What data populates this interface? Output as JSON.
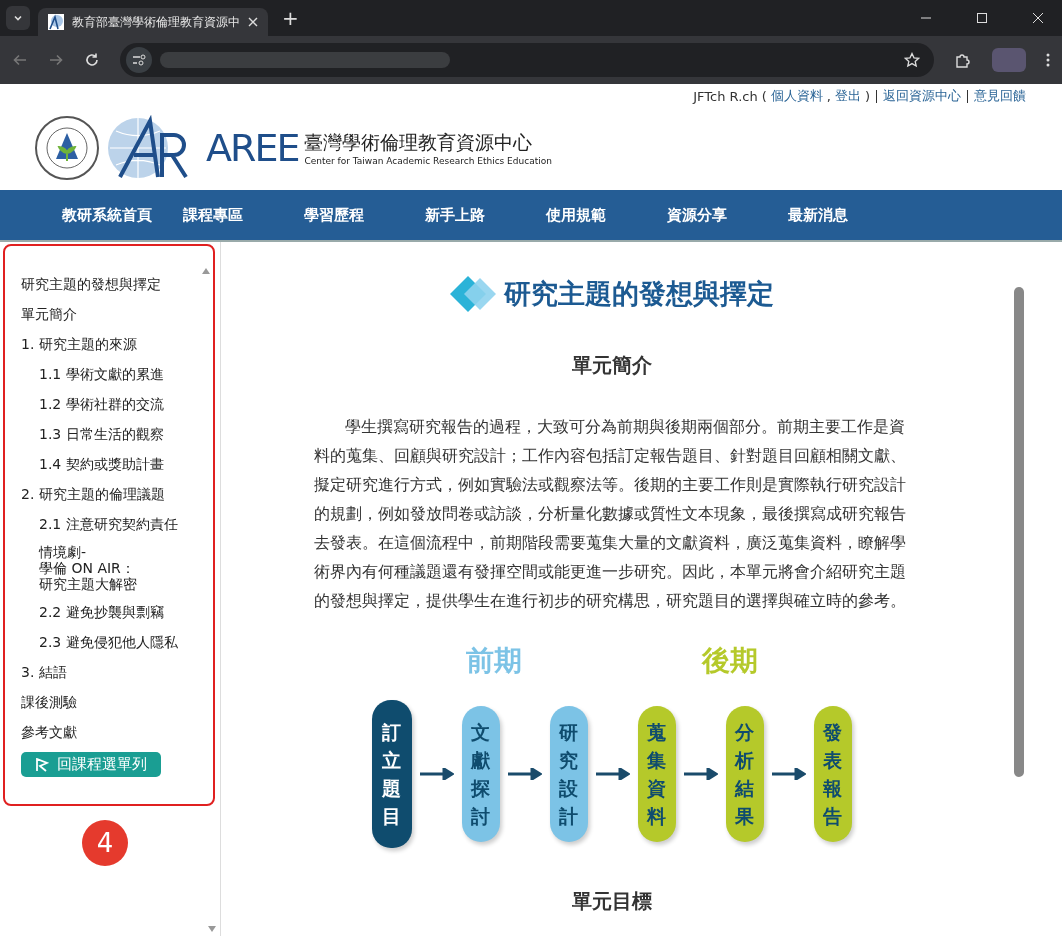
{
  "browser": {
    "tab_title": "教育部臺灣學術倫理教育資源中",
    "new_tab": "+"
  },
  "top_links": {
    "user": "JFTch R.ch",
    "open_paren": "(",
    "profile": "個人資料",
    "comma": ",",
    "logout": "登出",
    "close_paren": ")",
    "back": "返回資源中心",
    "feedback": "意見回饋"
  },
  "logo": {
    "title": "臺灣學術倫理教育資源中心",
    "subtitle": "Center for Taiwan Academic Research Ethics Education",
    "mark": "AREE"
  },
  "nav": [
    "教研系統首頁",
    "課程專區",
    "學習歷程",
    "新手上路",
    "使用規範",
    "資源分享",
    "最新消息"
  ],
  "sidebar": {
    "items": [
      {
        "label": "研究主題的發想與擇定"
      },
      {
        "label": "單元簡介"
      },
      {
        "label": "1. 研究主題的來源",
        "children": [
          {
            "label": "1.1 學術文獻的累進"
          },
          {
            "label": "1.2 學術社群的交流"
          },
          {
            "label": "1.3 日常生活的觀察"
          },
          {
            "label": "1.4 契約或獎助計畫"
          }
        ]
      },
      {
        "label": "2. 研究主題的倫理議題",
        "children": [
          {
            "label": "2.1 注意研究契約責任"
          },
          {
            "lines": [
              "情境劇-",
              "學倫 ON AIR：",
              "研究主題大解密"
            ]
          },
          {
            "label": "2.2 避免抄襲與剽竊"
          },
          {
            "label": "2.3 避免侵犯他人隱私"
          }
        ]
      },
      {
        "label": "3. 結語"
      },
      {
        "label": "課後測驗"
      },
      {
        "label": "參考文獻"
      }
    ],
    "back_button": "回課程選單列",
    "annotation": "4"
  },
  "content": {
    "title": "研究主題的發想與擇定",
    "intro_heading": "單元簡介",
    "intro": "學生撰寫研究報告的過程，大致可分為前期與後期兩個部分。前期主要工作是資料的蒐集、回顧與研究設計；工作內容包括訂定報告題目、針對題目回顧相關文獻、擬定研究進行方式，例如實驗法或觀察法等。後期的主要工作則是實際執行研究設計的規劃，例如發放問卷或訪談，分析量化數據或質性文本現象，最後撰寫成研究報告去發表。在這個流程中，前期階段需要蒐集大量的文獻資料，廣泛蒐集資料，瞭解學術界內有何種議題還有發揮空間或能更進一步研究。因此，本單元將會介紹研究主題的發想與擇定，提供學生在進行初步的研究構思，研究題目的選擇與確立時的參考。",
    "phases": [
      {
        "label": "前期",
        "color": "#7cc3e6"
      },
      {
        "label": "後期",
        "color": "#b5c92a"
      }
    ],
    "steps": [
      {
        "label": "訂立題目",
        "color": "#0f4c6e"
      },
      {
        "label": "文獻探討",
        "color": "#7cc3e6"
      },
      {
        "label": "研究設計",
        "color": "#7cc3e6"
      },
      {
        "label": "蒐集資料",
        "color": "#b5c92a"
      },
      {
        "label": "分析結果",
        "color": "#b5c92a"
      },
      {
        "label": "發表報告",
        "color": "#b5c92a"
      }
    ],
    "goals_heading": "單元目標"
  }
}
